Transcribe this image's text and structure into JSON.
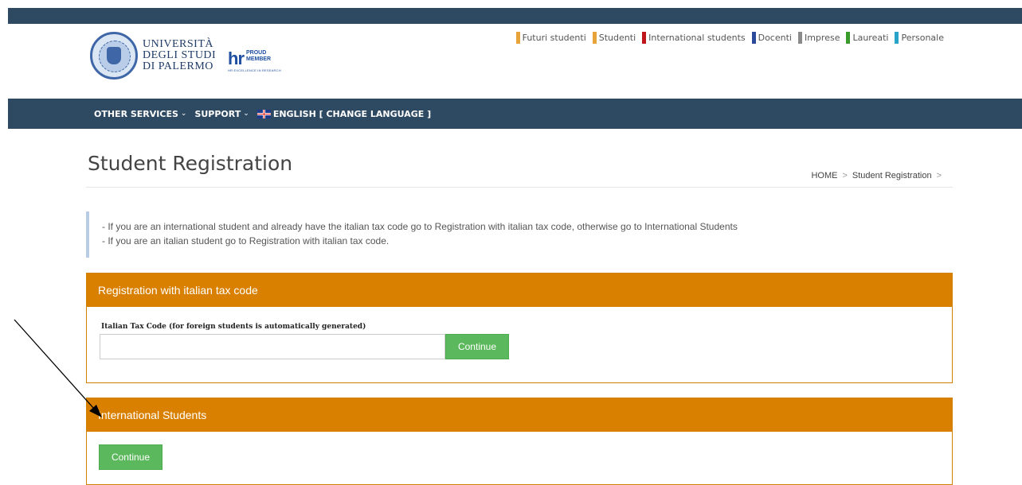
{
  "header": {
    "university": [
      "UNIVERSITÀ",
      "DEGLI STUDI",
      "DI PALERMO"
    ],
    "hr_logo": {
      "mark": "hr",
      "line1": "PROUD",
      "line2": "MEMBER",
      "tagline": "HR EXCELLENCE IN RESEARCH"
    },
    "top_links": [
      {
        "label": "Futuri studenti",
        "color": "#e8a33a"
      },
      {
        "label": "Studenti",
        "color": "#e8a33a"
      },
      {
        "label": "International students",
        "color": "#c0141b"
      },
      {
        "label": "Docenti",
        "color": "#2b4a9a"
      },
      {
        "label": "Imprese",
        "color": "#8a8a8a"
      },
      {
        "label": "Laureati",
        "color": "#3a9a2c"
      },
      {
        "label": "Personale",
        "color": "#2aa3c8"
      }
    ]
  },
  "nav": {
    "other_services": "OTHER SERVICES",
    "support": "SUPPORT",
    "language": "ENGLISH [ CHANGE LANGUAGE ]"
  },
  "page": {
    "title": "Student Registration",
    "breadcrumb": [
      "HOME",
      "Student Registration"
    ]
  },
  "info": {
    "line1": "- If you are an international student and already have the italian tax code go to Registration with italian tax code, otherwise go to International Students",
    "line2": "- If you are an italian student go to Registration with italian tax code."
  },
  "panel_tax": {
    "title": "Registration with italian tax code",
    "field_label": "Italian Tax Code (for foreign students is automatically generated)",
    "field_value": "",
    "button": "Continue"
  },
  "panel_international": {
    "title": "International Students",
    "button": "Continue"
  },
  "colors": {
    "brand_dark": "#2e4a63",
    "panel_orange": "#d98000",
    "button_green": "#5cb85c"
  }
}
